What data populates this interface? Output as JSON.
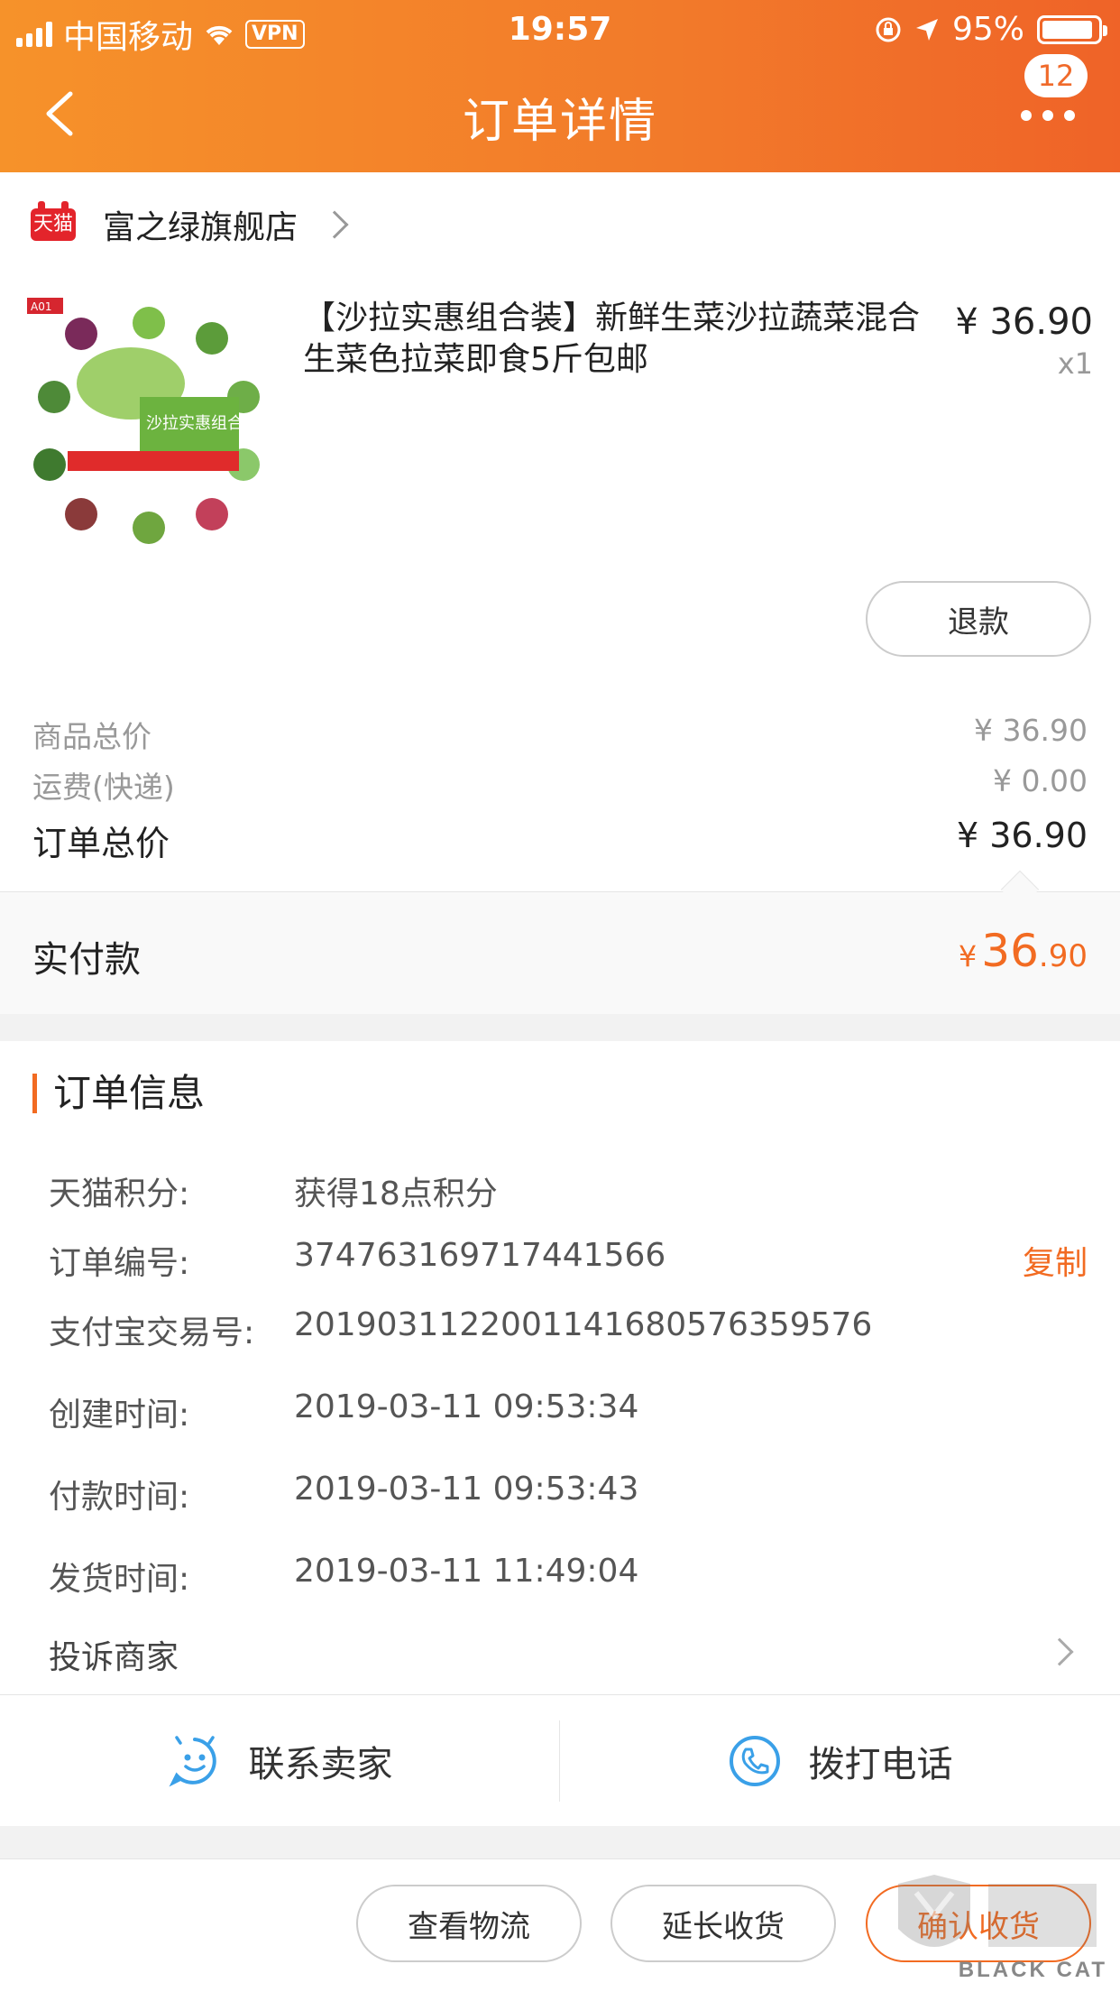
{
  "status_bar": {
    "carrier": "中国移动",
    "vpn": "VPN",
    "time": "19:57",
    "battery": "95%"
  },
  "nav": {
    "title": "订单详情",
    "badge_count": "12"
  },
  "store": {
    "badge": "天猫",
    "name": "富之绿旗舰店"
  },
  "product": {
    "title": "【沙拉实惠组合装】新鲜生菜沙拉蔬菜混合生菜色拉菜即食5斤包邮",
    "price": "¥ 36.90",
    "quantity": "x1",
    "thumb_label": "A01",
    "thumb_banner": "沙拉实惠组合装"
  },
  "refund_label": "退款",
  "summary": {
    "goods_label": "商品总价",
    "goods_value": "¥ 36.90",
    "shipping_label": "运费(快递)",
    "shipping_value": "¥ 0.00",
    "order_total_label": "订单总价",
    "order_total_value": "¥ 36.90",
    "paid_label": "实付款",
    "paid_currency": "¥",
    "paid_int": "36",
    "paid_dec": ".90"
  },
  "order_info": {
    "title": "订单信息",
    "rows": [
      {
        "k": "天猫积分:",
        "v": "获得18点积分"
      },
      {
        "k": "订单编号:",
        "v": "374763169717441566"
      },
      {
        "k": "支付宝交易号:",
        "v": "2019031122001141680576359576"
      },
      {
        "k": "创建时间:",
        "v": "2019-03-11 09:53:34"
      },
      {
        "k": "付款时间:",
        "v": "2019-03-11 09:53:43"
      },
      {
        "k": "发货时间:",
        "v": "2019-03-11 11:49:04"
      }
    ],
    "copy_label": "复制",
    "complain_label": "投诉商家"
  },
  "contact": {
    "seller_label": "联系卖家",
    "phone_label": "拨打电话"
  },
  "actions": {
    "logistics": "查看物流",
    "extend": "延长收货",
    "confirm": "确认收货"
  },
  "watermark": {
    "text": "BLACK CAT"
  },
  "colors": {
    "accent": "#f26b22",
    "header_start": "#f6922a",
    "header_end": "#ef6328",
    "tmall_red": "#e3242b",
    "icon_blue": "#3aa0e8"
  }
}
